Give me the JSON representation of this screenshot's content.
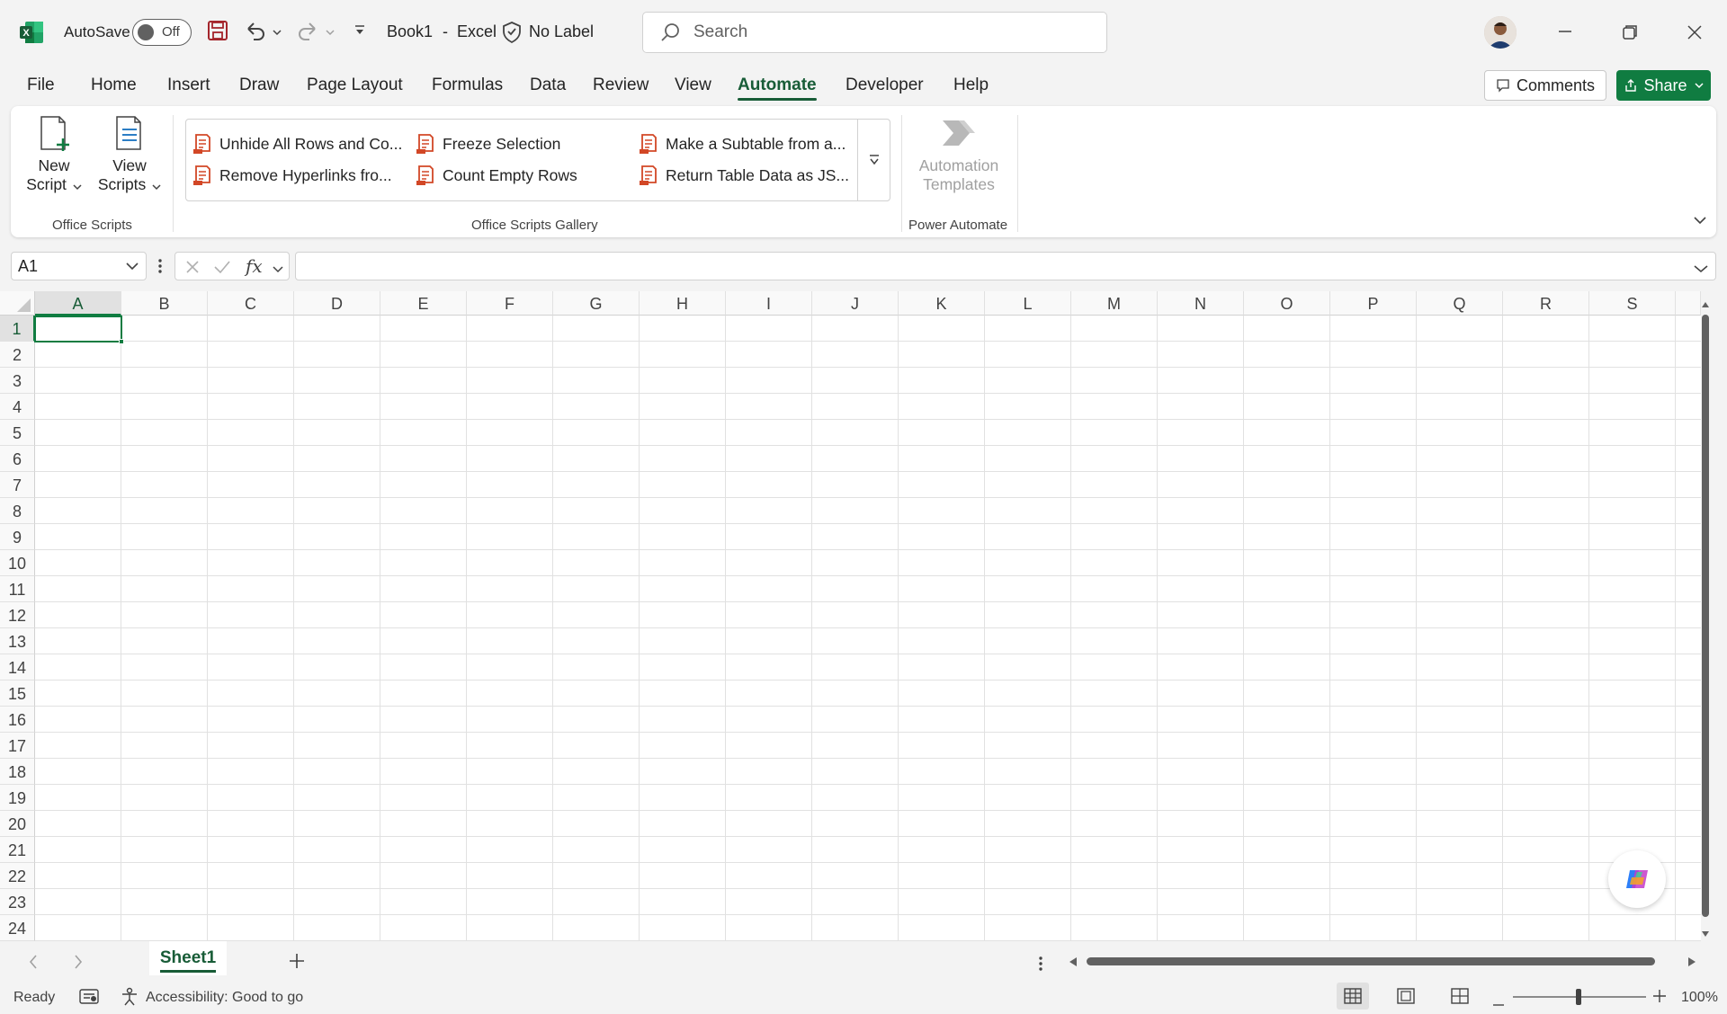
{
  "titlebar": {
    "autosave_label": "AutoSave",
    "autosave_state": "Off",
    "file_name": "Book1",
    "separator": "-",
    "app_name": "Excel",
    "sensitivity_label": "No Label",
    "search_placeholder": "Search"
  },
  "menu": {
    "tabs": [
      "File",
      "Home",
      "Insert",
      "Draw",
      "Page Layout",
      "Formulas",
      "Data",
      "Review",
      "View",
      "Automate",
      "Developer",
      "Help"
    ],
    "active_tab": "Automate",
    "comments_label": "Comments",
    "share_label": "Share"
  },
  "ribbon": {
    "new_script_line1": "New",
    "new_script_line2": "Script",
    "view_scripts_line1": "View",
    "view_scripts_line2": "Scripts",
    "office_scripts_group": "Office Scripts",
    "gallery_items": [
      "Unhide All Rows and Co...",
      "Freeze Selection",
      "Make a Subtable from a...",
      "Remove Hyperlinks fro...",
      "Count Empty Rows",
      "Return Table Data as JS..."
    ],
    "gallery_group": "Office Scripts Gallery",
    "automation_templates_line1": "Automation",
    "automation_templates_line2": "Templates",
    "power_automate_group": "Power Automate"
  },
  "formula_bar": {
    "name_box": "A1",
    "fx": "fx",
    "value": ""
  },
  "grid": {
    "columns": [
      "A",
      "B",
      "C",
      "D",
      "E",
      "F",
      "G",
      "H",
      "I",
      "J",
      "K",
      "L",
      "M",
      "N",
      "O",
      "P",
      "Q",
      "R",
      "S"
    ],
    "rows": [
      "1",
      "2",
      "3",
      "4",
      "5",
      "6",
      "7",
      "8",
      "9",
      "10",
      "11",
      "12",
      "13",
      "14",
      "15",
      "16",
      "17",
      "18",
      "19",
      "20",
      "21",
      "22",
      "23",
      "24"
    ],
    "active_cell": "A1"
  },
  "sheets": {
    "tabs": [
      "Sheet1"
    ],
    "active": "Sheet1"
  },
  "status": {
    "ready": "Ready",
    "accessibility": "Accessibility: Good to go",
    "zoom": "100%"
  },
  "colors": {
    "excel_green": "#185c37",
    "share_green": "#107c41",
    "script_orange": "#d24726"
  }
}
